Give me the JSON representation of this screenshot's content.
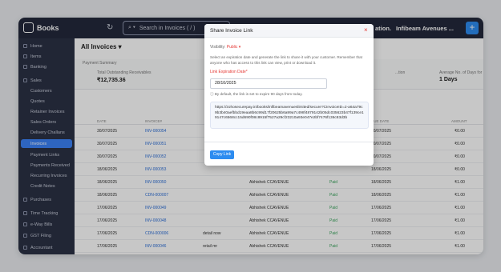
{
  "app": {
    "name": "Books",
    "search_placeholder": "Search in Invoices ( / )",
    "org_partial": "ation.",
    "org_name": "Infibeam Avenues ..."
  },
  "sidebar": {
    "items": [
      {
        "label": "Home"
      },
      {
        "label": "Items"
      },
      {
        "label": "Banking"
      },
      {
        "label": "Sales"
      }
    ],
    "sub": [
      {
        "label": "Customers"
      },
      {
        "label": "Quotes"
      },
      {
        "label": "Retainer Invoices"
      },
      {
        "label": "Sales Orders"
      },
      {
        "label": "Delivery Challans"
      },
      {
        "label": "Invoices",
        "active": true
      },
      {
        "label": "Payment Links"
      },
      {
        "label": "Payments Received"
      },
      {
        "label": "Recurring Invoices"
      },
      {
        "label": "Credit Notes"
      }
    ],
    "bottom": [
      {
        "label": "Purchases"
      },
      {
        "label": "Time Tracking"
      },
      {
        "label": "e-Way Bills"
      },
      {
        "label": "GST Filing"
      },
      {
        "label": "Accountant"
      }
    ]
  },
  "main": {
    "title": "All Invoices ▾",
    "summary_title": "Payment Summary",
    "outstanding_label": "Total Outstanding Receivables",
    "outstanding_value": "₹12,735.36",
    "right_label_1": "...tion",
    "right_label_2": "Average No. of Days for",
    "right_value_2": "1 Days",
    "columns": [
      "DATE",
      "INVOICE#",
      "",
      "",
      "",
      "",
      "DUE DATE",
      "AMOUNT"
    ],
    "rows": [
      {
        "date": "30/07/2025",
        "inv": "INV-000054",
        "cust": "",
        "status": "",
        "due": "30/07/2025",
        "amount": "₹0.00"
      },
      {
        "date": "30/07/2025",
        "inv": "INV-000051",
        "cust": "",
        "status": "",
        "due": "30/07/2025",
        "amount": "₹0.00"
      },
      {
        "date": "30/07/2025",
        "inv": "INV-000052",
        "cust": "",
        "status": "",
        "due": "30/07/2025",
        "amount": "₹0.00"
      },
      {
        "date": "18/06/2025",
        "inv": "INV-000053",
        "cust": "",
        "status": "",
        "due": "18/06/2025",
        "amount": "₹0.00"
      },
      {
        "date": "18/06/2025",
        "inv": "INV-000050",
        "cust": "Abhishek CCAVENUE",
        "status": "Paid",
        "due": "18/06/2025",
        "amount": "₹1.00"
      },
      {
        "date": "18/06/2025",
        "inv": "CDN-000007",
        "cust": "Abhishek CCAVENUE",
        "status": "Paid",
        "due": "18/06/2025",
        "amount": "₹1.00"
      },
      {
        "date": "17/06/2025",
        "inv": "INV-000049",
        "cust": "Abhishek CCAVENUE",
        "status": "Paid",
        "due": "17/06/2025",
        "amount": "₹1.00"
      },
      {
        "date": "17/06/2025",
        "inv": "INV-000048",
        "cust": "Abhishek CCAVENUE",
        "status": "Paid",
        "due": "17/06/2025",
        "amount": "₹1.00"
      },
      {
        "date": "17/06/2025",
        "inv": "CDN-000006",
        "cust": "Abhishek CCAVENUE",
        "status": "Paid",
        "due": "17/06/2025",
        "amount": "₹1.00",
        "ref": "detail now"
      },
      {
        "date": "17/06/2025",
        "inv": "INV-000046",
        "cust": "Abhishek CCAVENUE",
        "status": "Paid",
        "due": "17/06/2025",
        "amount": "₹1.00",
        "ref": "retail mr"
      }
    ]
  },
  "modal": {
    "title": "Share Invoice Link",
    "close": "×",
    "visibility_label": "Visibility:",
    "visibility_value": "Public ▾",
    "description": "Select an expiration date and generate the link to share it with your customer. Remember that anyone who has access to this link can view, print or download it.",
    "expiry_label": "Link Expiration Date*",
    "expiry_value": "28/10/2025",
    "note": "ⓘ By default, the link is set to expire 90 days from today.",
    "link": "https://zohosecurepay.in/books/infibeamavenueslimited/secure?CInvoiceID=2-a64a79c9b3b40aefbbd19eaa8b6c99d17f20625b6a99a7c498f4879142b05dc035623b47f139ce19147c6568cc15d690f08c8915f7527a29cf23210a93e047e2bf7476f136c83d3b",
    "button": "Copy Link"
  }
}
